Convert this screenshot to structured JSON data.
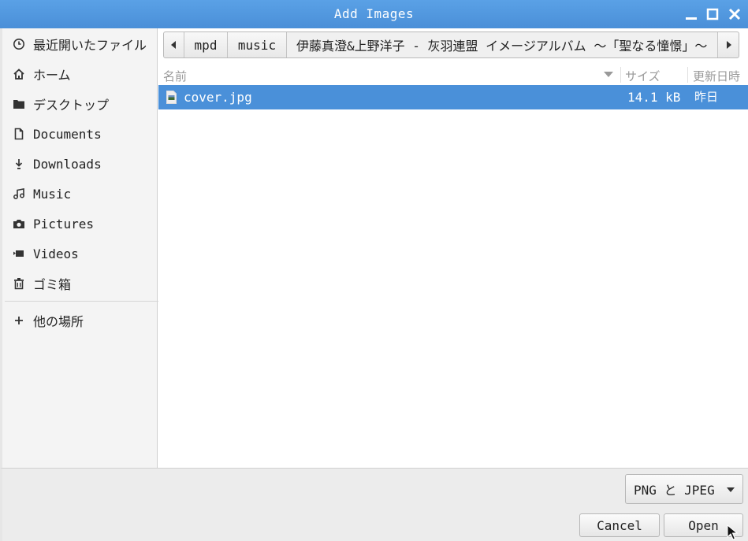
{
  "window": {
    "title": "Add Images"
  },
  "sidebar": {
    "items": [
      {
        "label": "最近開いたファイル",
        "icon": "clock-icon"
      },
      {
        "label": "ホーム",
        "icon": "home-icon"
      },
      {
        "label": "デスクトップ",
        "icon": "folder-icon"
      },
      {
        "label": "Documents",
        "icon": "document-icon"
      },
      {
        "label": "Downloads",
        "icon": "download-icon"
      },
      {
        "label": "Music",
        "icon": "music-icon"
      },
      {
        "label": "Pictures",
        "icon": "camera-icon"
      },
      {
        "label": "Videos",
        "icon": "video-icon"
      },
      {
        "label": "ゴミ箱",
        "icon": "trash-icon"
      }
    ],
    "other_locations": {
      "label": "他の場所",
      "icon": "plus-icon"
    }
  },
  "pathbar": {
    "segments": [
      "mpd",
      "music",
      "伊藤真澄&上野洋子 - 灰羽連盟 イメージアルバム 〜「聖なる憧憬」〜"
    ]
  },
  "columns": {
    "name": "名前",
    "size": "サイズ",
    "modified": "更新日時"
  },
  "files": [
    {
      "name": "cover.jpg",
      "size": "14.1 kB",
      "modified": "昨日",
      "selected": true
    }
  ],
  "filter": {
    "selected": "PNG と JPEG"
  },
  "buttons": {
    "cancel": "Cancel",
    "open": "Open"
  },
  "colors": {
    "accent": "#4a90d9",
    "titlebar": "#4f95dd"
  }
}
